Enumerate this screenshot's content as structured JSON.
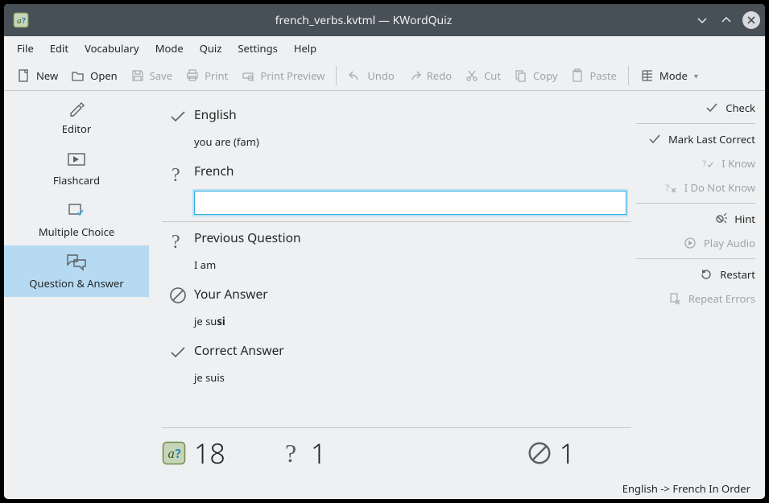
{
  "window": {
    "title": "french_verbs.kvtml — KWordQuiz"
  },
  "menu": [
    "File",
    "Edit",
    "Vocabulary",
    "Mode",
    "Quiz",
    "Settings",
    "Help"
  ],
  "toolbar": {
    "new_label": "New",
    "open_label": "Open",
    "save_label": "Save",
    "print_label": "Print",
    "preview_label": "Print Preview",
    "undo_label": "Undo",
    "redo_label": "Redo",
    "cut_label": "Cut",
    "copy_label": "Copy",
    "paste_label": "Paste",
    "mode_label": "Mode"
  },
  "sidebar": {
    "items": [
      {
        "label": "Editor"
      },
      {
        "label": "Flashcard"
      },
      {
        "label": "Multiple Choice"
      },
      {
        "label": "Question & Answer"
      }
    ],
    "selected_index": 3
  },
  "quiz": {
    "english_label": "English",
    "english_value": "you are (fam)",
    "french_label": "French",
    "french_value": "",
    "prev_label": "Previous Question",
    "prev_value": "I am",
    "your_label": "Your Answer",
    "your_value_prefix": "je su",
    "your_value_bold": "si",
    "correct_label": "Correct Answer",
    "correct_value": "je suis"
  },
  "scores": {
    "remaining": "18",
    "unanswered": "1",
    "wrong": "1"
  },
  "rightbar": {
    "check_label": "Check",
    "mark_last_label": "Mark Last Correct",
    "i_know_label": "I Know",
    "i_do_not_know_label": "I Do Not Know",
    "hint_label": "Hint",
    "play_audio_label": "Play Audio",
    "restart_label": "Restart",
    "repeat_errors_label": "Repeat Errors"
  },
  "statusbar": {
    "text": "English -> French In Order"
  }
}
